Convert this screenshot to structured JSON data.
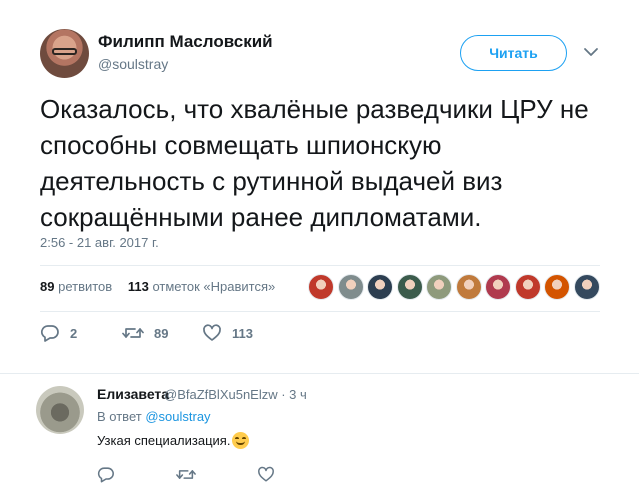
{
  "tweet": {
    "author_name": "Филипп Масловский",
    "author_handle": "@soulstray",
    "follow_label": "Читать",
    "text": "Оказалось, что хвалёные разведчики ЦРУ не способны совмещать шпионскую деятельность с рутинной выдачей виз сокращёнными ранее дипломатами.",
    "timestamp": "2:56 - 21 авг. 2017 г.",
    "retweets_count": "89",
    "retweets_label": "ретвитов",
    "likes_count": "113",
    "likes_label": "отметок «Нравится»",
    "likers_colors": [
      "#c0392b",
      "#7f8c8d",
      "#2c3e50",
      "#3b5b4c",
      "#8e9a7c",
      "#c07a3c",
      "#b03a4e",
      "#c0392b",
      "#d35400",
      "#34495e"
    ],
    "actions": {
      "reply_count": "2",
      "retweet_count": "89",
      "like_count": "113"
    }
  },
  "reply": {
    "author_name": "Елизавета",
    "meta": "@BfaZfBlXu5nElzw · 3 ч",
    "reply_prefix": "В ответ",
    "reply_handle": "@soulstray",
    "text": "Узкая специализация."
  },
  "colors": {
    "accent": "#1da1f2",
    "muted": "#657786",
    "text": "#14171a",
    "divider": "#e6ecf0"
  }
}
